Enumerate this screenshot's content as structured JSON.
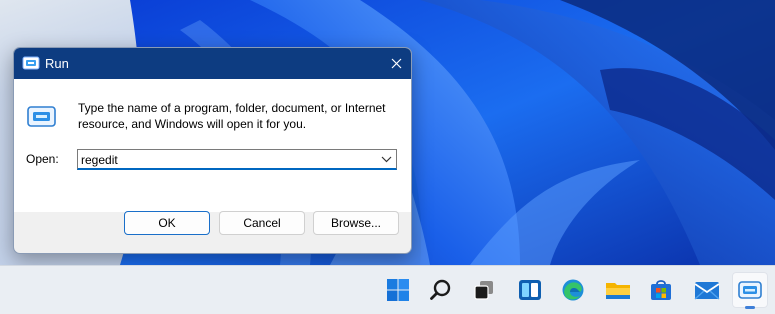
{
  "window": {
    "title": "Run",
    "description": "Type the name of a program, folder, document, or Internet resource, and Windows will open it for you.",
    "open_label": "Open:",
    "open_value": "regedit",
    "ok_label": "OK",
    "cancel_label": "Cancel",
    "browse_label": "Browse..."
  },
  "taskbar": {
    "icons": [
      "windows-start-icon",
      "search-icon",
      "task-view-icon",
      "widgets-icon",
      "edge-icon",
      "file-explorer-icon",
      "microsoft-store-icon",
      "mail-icon",
      "run-icon"
    ],
    "active": "run-icon"
  },
  "colors": {
    "titlebar": "#0d3c81",
    "accent": "#0067c0",
    "taskbar": "#eaeef3"
  }
}
